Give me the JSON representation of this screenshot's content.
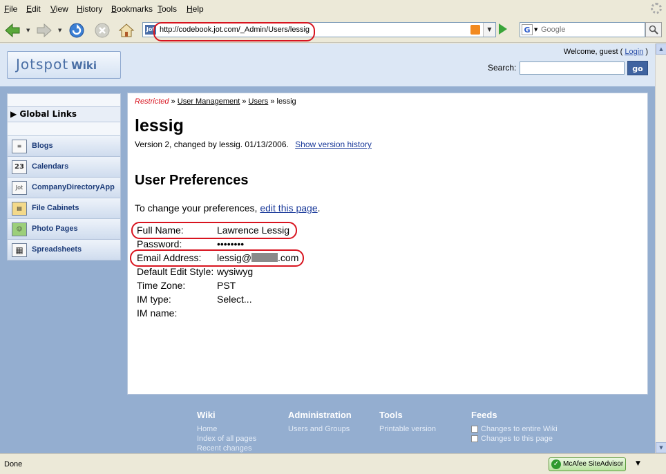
{
  "menu": [
    "File",
    "Edit",
    "View",
    "History",
    "Bookmarks",
    "Tools",
    "Help"
  ],
  "navbar": {
    "url": "http://codebook.jot.com/_Admin/Users/lessig",
    "favicon_label": "Jot",
    "search_engine": "G",
    "search_placeholder": "Google"
  },
  "header": {
    "logo_text": "Jotspot",
    "logo_wiki": "Wiki",
    "welcome_prefix": "Welcome, guest (",
    "login_link": "Login",
    "welcome_suffix": ")",
    "search_label": "Search:",
    "go_label": "go"
  },
  "sidebar": {
    "global_links": "Global Links",
    "apps": [
      {
        "label": "Blogs",
        "icon": "blog-icon"
      },
      {
        "label": "Calendars",
        "icon": "calendar-icon",
        "glyph": "23"
      },
      {
        "label": "CompanyDirectoryApp",
        "icon": "jot-icon",
        "glyph": "Jot"
      },
      {
        "label": "File Cabinets",
        "icon": "file-cabinet-icon"
      },
      {
        "label": "Photo Pages",
        "icon": "photo-icon"
      },
      {
        "label": "Spreadsheets",
        "icon": "spreadsheet-icon"
      }
    ]
  },
  "content": {
    "breadcrumb": {
      "restricted": "Restricted",
      "sep": "»",
      "user_management": "User Management",
      "users": "Users",
      "current": "lessig"
    },
    "title": "lessig",
    "version_text": "Version 2, changed by lessig. 01/13/2006.",
    "version_link": "Show version history",
    "prefs_heading": "User Preferences",
    "change_prefix": "To change your preferences, ",
    "change_link": "edit this page",
    "change_suffix": ".",
    "prefs": [
      {
        "label": "Full Name:",
        "value": "Lawrence Lessig"
      },
      {
        "label": "Password:",
        "value": "••••••••"
      },
      {
        "label": "Email Address:",
        "value_prefix": "lessig@",
        "value_suffix": ".com"
      },
      {
        "label": "Default Edit Style:",
        "value": "wysiwyg"
      },
      {
        "label": "Time Zone:",
        "value": "PST"
      },
      {
        "label": "IM type:",
        "value": "Select..."
      },
      {
        "label": "IM name:",
        "value": ""
      }
    ]
  },
  "footer": {
    "wiki": {
      "head": "Wiki",
      "links": [
        "Home",
        "Index of all pages",
        "Recent changes"
      ]
    },
    "administration": {
      "head": "Administration",
      "links": [
        "Users and Groups"
      ]
    },
    "tools": {
      "head": "Tools",
      "links": [
        "Printable version"
      ]
    },
    "feeds": {
      "head": "Feeds",
      "links": [
        "Changes to entire Wiki",
        "Changes to this page"
      ]
    }
  },
  "status": {
    "text": "Done",
    "mcafee": "McAfee SiteAdvisor"
  },
  "colors": {
    "page_bg": "#94aed0",
    "highlight": "#d8141f",
    "link": "#1a3a9a"
  }
}
